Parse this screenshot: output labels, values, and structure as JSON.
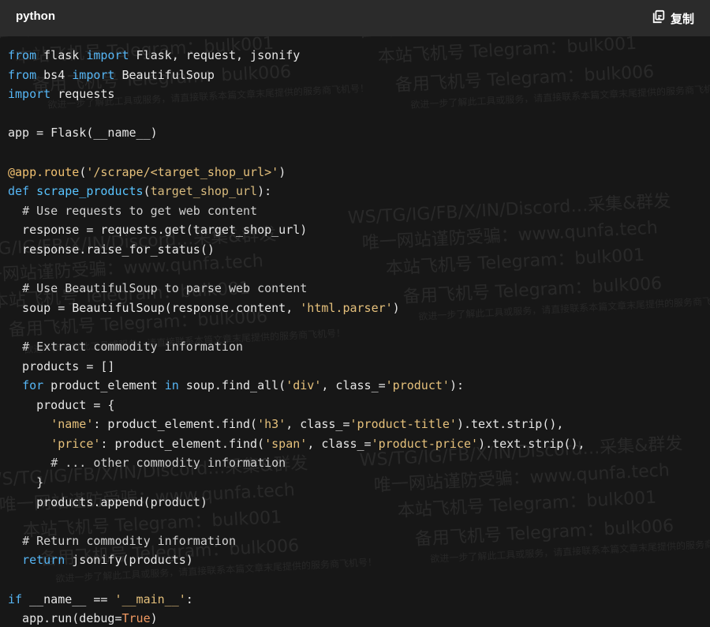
{
  "header": {
    "language": "python",
    "copy_label": "复制"
  },
  "watermark": {
    "lines": [
      "WS/TG/IG/FB/X/IN/Discord…采集&群发",
      "唯一网站谨防受骗：www.qunfa.tech",
      "本站飞机号 Telegram：bulk001",
      "备用飞机号 Telegram：bulk006",
      "欲进一步了解此工具或服务，请直接联系本篇文章末尾提供的服务商飞机号！"
    ]
  },
  "code_lines": [
    "from flask import Flask, request, jsonify",
    "from bs4 import BeautifulSoup",
    "import requests",
    "",
    "app = Flask(__name__)",
    "",
    "@app.route('/scrape/<target_shop_url>')",
    "def scrape_products(target_shop_url):",
    "  # Use requests to get web content",
    "  response = requests.get(target_shop_url)",
    "  response.raise_for_status()",
    "",
    "  # Use BeautifulSoup to parse web content",
    "  soup = BeautifulSoup(response.content, 'html.parser')",
    "",
    "  # Extract commodity information",
    "  products = []",
    "  for product_element in soup.find_all('div', class_='product'):",
    "    product = {",
    "      'name': product_element.find('h3', class_='product-title').text.strip(),",
    "      'price': product_element.find('span', class_='product-price').text.strip(),",
    "      # ... other commodity information",
    "    }",
    "    products.append(product)",
    "",
    "  # Return commodity information",
    "  return jsonify(products)",
    "",
    "if __name__ == '__main__':",
    "  app.run(debug=True)"
  ]
}
